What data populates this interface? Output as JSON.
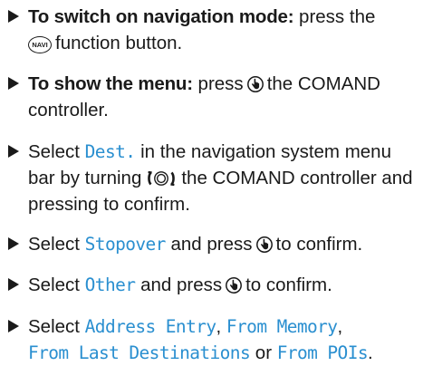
{
  "steps": [
    {
      "bold": "To switch on navigation mode:",
      "t1": " press the",
      "icon_label": "NAVI",
      "t2": "function button."
    },
    {
      "bold": "To show the menu:",
      "t1": " press",
      "t2": "the COMAND controller."
    },
    {
      "t1": "Select ",
      "code": "Dest.",
      "t2": " in the navigation system menu bar by turning",
      "t3": "the COMAND controller and pressing",
      "t4": "to confirm."
    },
    {
      "t1": "Select ",
      "code": "Stopover",
      "t2": " and press",
      "t3": "to confirm."
    },
    {
      "t1": "Select ",
      "code": "Other",
      "t2": " and press",
      "t3": "to confirm."
    },
    {
      "t1": "Select ",
      "code1": "Address Entry",
      "sep1": ", ",
      "code2": "From Memory",
      "sep2": ", ",
      "code3": "From Last Destinations",
      "sep3": " or ",
      "code4": "From POIs",
      "end": "."
    }
  ],
  "icons": {
    "navi": "navi-button-icon",
    "press": "controller-press-icon",
    "turn": "controller-turn-icon"
  }
}
